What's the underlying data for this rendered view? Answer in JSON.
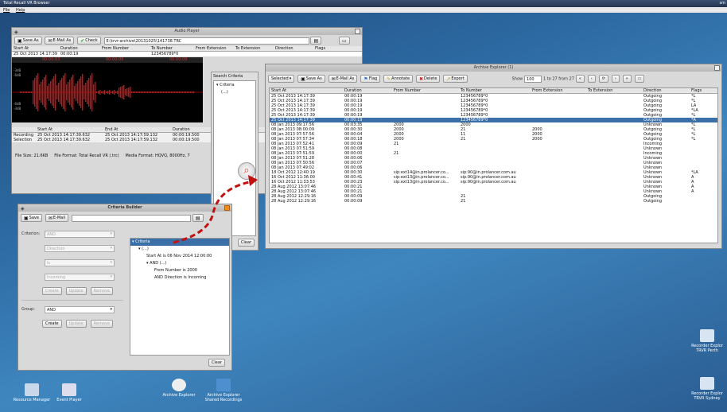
{
  "app": {
    "title": "Total Recall VR Browser",
    "menu": [
      "File",
      "Help"
    ],
    "topright_text": "sm"
  },
  "audio_player": {
    "title": "Audio Player",
    "toolbar": {
      "save_as": "Save As",
      "email_as": "E-Mail As",
      "check": "Check",
      "path": "E:\\trvr-archive\\20131025\\141738.TRC"
    },
    "headers": [
      "Start At",
      "Duration",
      "From Number",
      "To Number",
      "From Extension",
      "To Extension",
      "Direction",
      "Flags"
    ],
    "row": [
      "25 Oct 2013 14:17:39",
      "00:00:19",
      "",
      "123456789*0"
    ],
    "times": [
      "00:00:03",
      "00:00:06",
      "00:00:09"
    ],
    "db_labels": [
      "-3dB",
      "-6dB",
      "-6dB",
      "-3dB"
    ],
    "rec_table": {
      "headers": [
        "",
        "Start At",
        "End At",
        "Duration"
      ],
      "rows": [
        [
          "Recording",
          "25 Oct 2013 14:17:39.632",
          "25 Oct 2013 14:17:59.132",
          "00:00:19.500"
        ],
        [
          "Selection",
          "25 Oct 2013 14:17:39.632",
          "25 Oct 2013 14:17:59.132",
          "00:00:19.500"
        ]
      ]
    },
    "status": "File Size: 21.6KB     File Format: Total Recall VR (.trc)     Media Format: HQVQ, 8000Hz, 7"
  },
  "search_criteria": {
    "title": "Search Criteria",
    "tree": [
      "Criteria",
      "(...)"
    ],
    "clear": "Clear"
  },
  "archive_explorer": {
    "title": "Archive Explorer (1)",
    "toolbar": {
      "selected": "Selected",
      "save_as": "Save As",
      "email_as": "E-Mail As",
      "flag": "Flag",
      "annotate": "Annotate",
      "delete": "Delete",
      "export": "Export",
      "show_label": "Show",
      "show_value": "100",
      "range": "1 to 27 from 27"
    },
    "headers": [
      "Start At",
      "Duration",
      "From Number",
      "To Number",
      "From Extension",
      "To Extension",
      "Direction",
      "Flags"
    ],
    "rows": [
      [
        "25 Oct 2013 14:17:39",
        "00:00:19",
        "",
        "123456789*0",
        "",
        "",
        "Outgoing",
        "*L"
      ],
      [
        "25 Oct 2013 14:17:39",
        "00:00:19",
        "",
        "123456789*0",
        "",
        "",
        "Outgoing",
        "*L"
      ],
      [
        "25 Oct 2013 14:17:39",
        "00:00:19",
        "",
        "123456789*0",
        "",
        "",
        "Outgoing",
        "LA"
      ],
      [
        "25 Oct 2013 14:17:39",
        "00:00:19",
        "",
        "123456789*0",
        "",
        "",
        "Outgoing",
        "*LA"
      ],
      [
        "25 Oct 2013 14:17:39",
        "00:00:19",
        "",
        "123456789*0",
        "",
        "",
        "Outgoing",
        "*L"
      ],
      [
        "25 Oct 2013 14:17:39",
        "00:00:19",
        "",
        "123456789*0",
        "",
        "",
        "Outgoing",
        "*A"
      ],
      [
        "08 Jan 2013 09:17:56",
        "00:03:35",
        "2000",
        "2000",
        "",
        "",
        "Unknown",
        "*L"
      ],
      [
        "08 Jan 2013 08:00:09",
        "00:00:30",
        "2000",
        "21",
        "2000",
        "",
        "Outgoing",
        "*L"
      ],
      [
        "08 Jan 2013 07:57:56",
        "00:00:04",
        "2000",
        "11",
        "2000",
        "",
        "Outgoing",
        "*L"
      ],
      [
        "08 Jan 2013 07:57:34",
        "00:00:18",
        "2000",
        "21",
        "2000",
        "",
        "Outgoing",
        "*L"
      ],
      [
        "08 Jan 2013 07:52:41",
        "00:00:09",
        "21",
        "",
        "",
        "",
        "Incoming",
        ""
      ],
      [
        "08 Jan 2013 07:51:59",
        "00:00:08",
        "",
        "",
        "",
        "",
        "Unknown",
        ""
      ],
      [
        "08 Jan 2013 07:51:59",
        "00:00:00",
        "21",
        "",
        "",
        "",
        "Incoming",
        ""
      ],
      [
        "08 Jan 2013 07:51:28",
        "00:00:06",
        "",
        "",
        "",
        "",
        "Unknown",
        ""
      ],
      [
        "08 Jan 2013 07:50:56",
        "00:00:07",
        "",
        "",
        "",
        "",
        "Unknown",
        ""
      ],
      [
        "08 Jan 2013 07:49:02",
        "00:00:06",
        "",
        "",
        "",
        "",
        "Unknown",
        ""
      ],
      [
        "18 Oct 2012 12:40:19",
        "00:00:30",
        "sip:ext14@in.prolancer.co...",
        "sip:90@in.prolancer.com.au",
        "",
        "",
        "Unknown",
        "*LA"
      ],
      [
        "16 Oct 2012 11:36:00",
        "00:00:41",
        "sip:ext13@in.prolancer.co...",
        "sip:90@in.prolancer.com.au",
        "",
        "",
        "Unknown",
        "A"
      ],
      [
        "16 Oct 2012 11:33:53",
        "00:00:23",
        "sip:ext13@in.prolancer.co...",
        "sip:90@in.prolancer.com.au",
        "",
        "",
        "Unknown",
        "A"
      ],
      [
        "28 Aug 2012 13:07:46",
        "00:00:21",
        "",
        "",
        "",
        "",
        "Unknown",
        "A"
      ],
      [
        "28 Aug 2012 13:07:46",
        "00:00:21",
        "",
        "",
        "",
        "",
        "Unknown",
        "A"
      ],
      [
        "28 Aug 2012 12:29:16",
        "00:00:09",
        "",
        "21",
        "",
        "",
        "Outgoing",
        ""
      ],
      [
        "28 Aug 2012 12:29:16",
        "00:00:09",
        "",
        "21",
        "",
        "",
        "Outgoing",
        ""
      ]
    ],
    "selected_row": 5
  },
  "criteria_builder": {
    "title": "Criteria Builder",
    "toolbar": {
      "save": "Save",
      "email": "E-Mail"
    },
    "criterion_label": "Criterion:",
    "criterion_value": "AND",
    "fields": [
      "Direction",
      "is",
      "Incoming"
    ],
    "buttons": [
      "Create",
      "Update",
      "Remove"
    ],
    "group_label": "Group:",
    "group_value": "AND",
    "group_buttons": [
      "Create",
      "Update",
      "Remove"
    ],
    "tree": [
      "Criteria",
      "(...)",
      "Start At is 06 Nov 2014 12:00:00",
      "AND (...)",
      "From Number is 2000",
      "AND Direction is Incoming"
    ],
    "clear": "Clear"
  },
  "desktop": {
    "taskbar": [
      "Resource Manager",
      "Event Player",
      "Archive Explorer",
      "Archive Explorer"
    ],
    "taskbar_sub": [
      "",
      "",
      "",
      "Shared Recordings"
    ],
    "right_icons": [
      {
        "label": "Recorder Explor",
        "sub": "TRVR Perth"
      },
      {
        "label": "Recorder Explor",
        "sub": "TRVR Sydney"
      }
    ]
  },
  "colors": {
    "waveform": "#d01010",
    "arrow": "#c01010",
    "selection": "#3b6fa8"
  }
}
